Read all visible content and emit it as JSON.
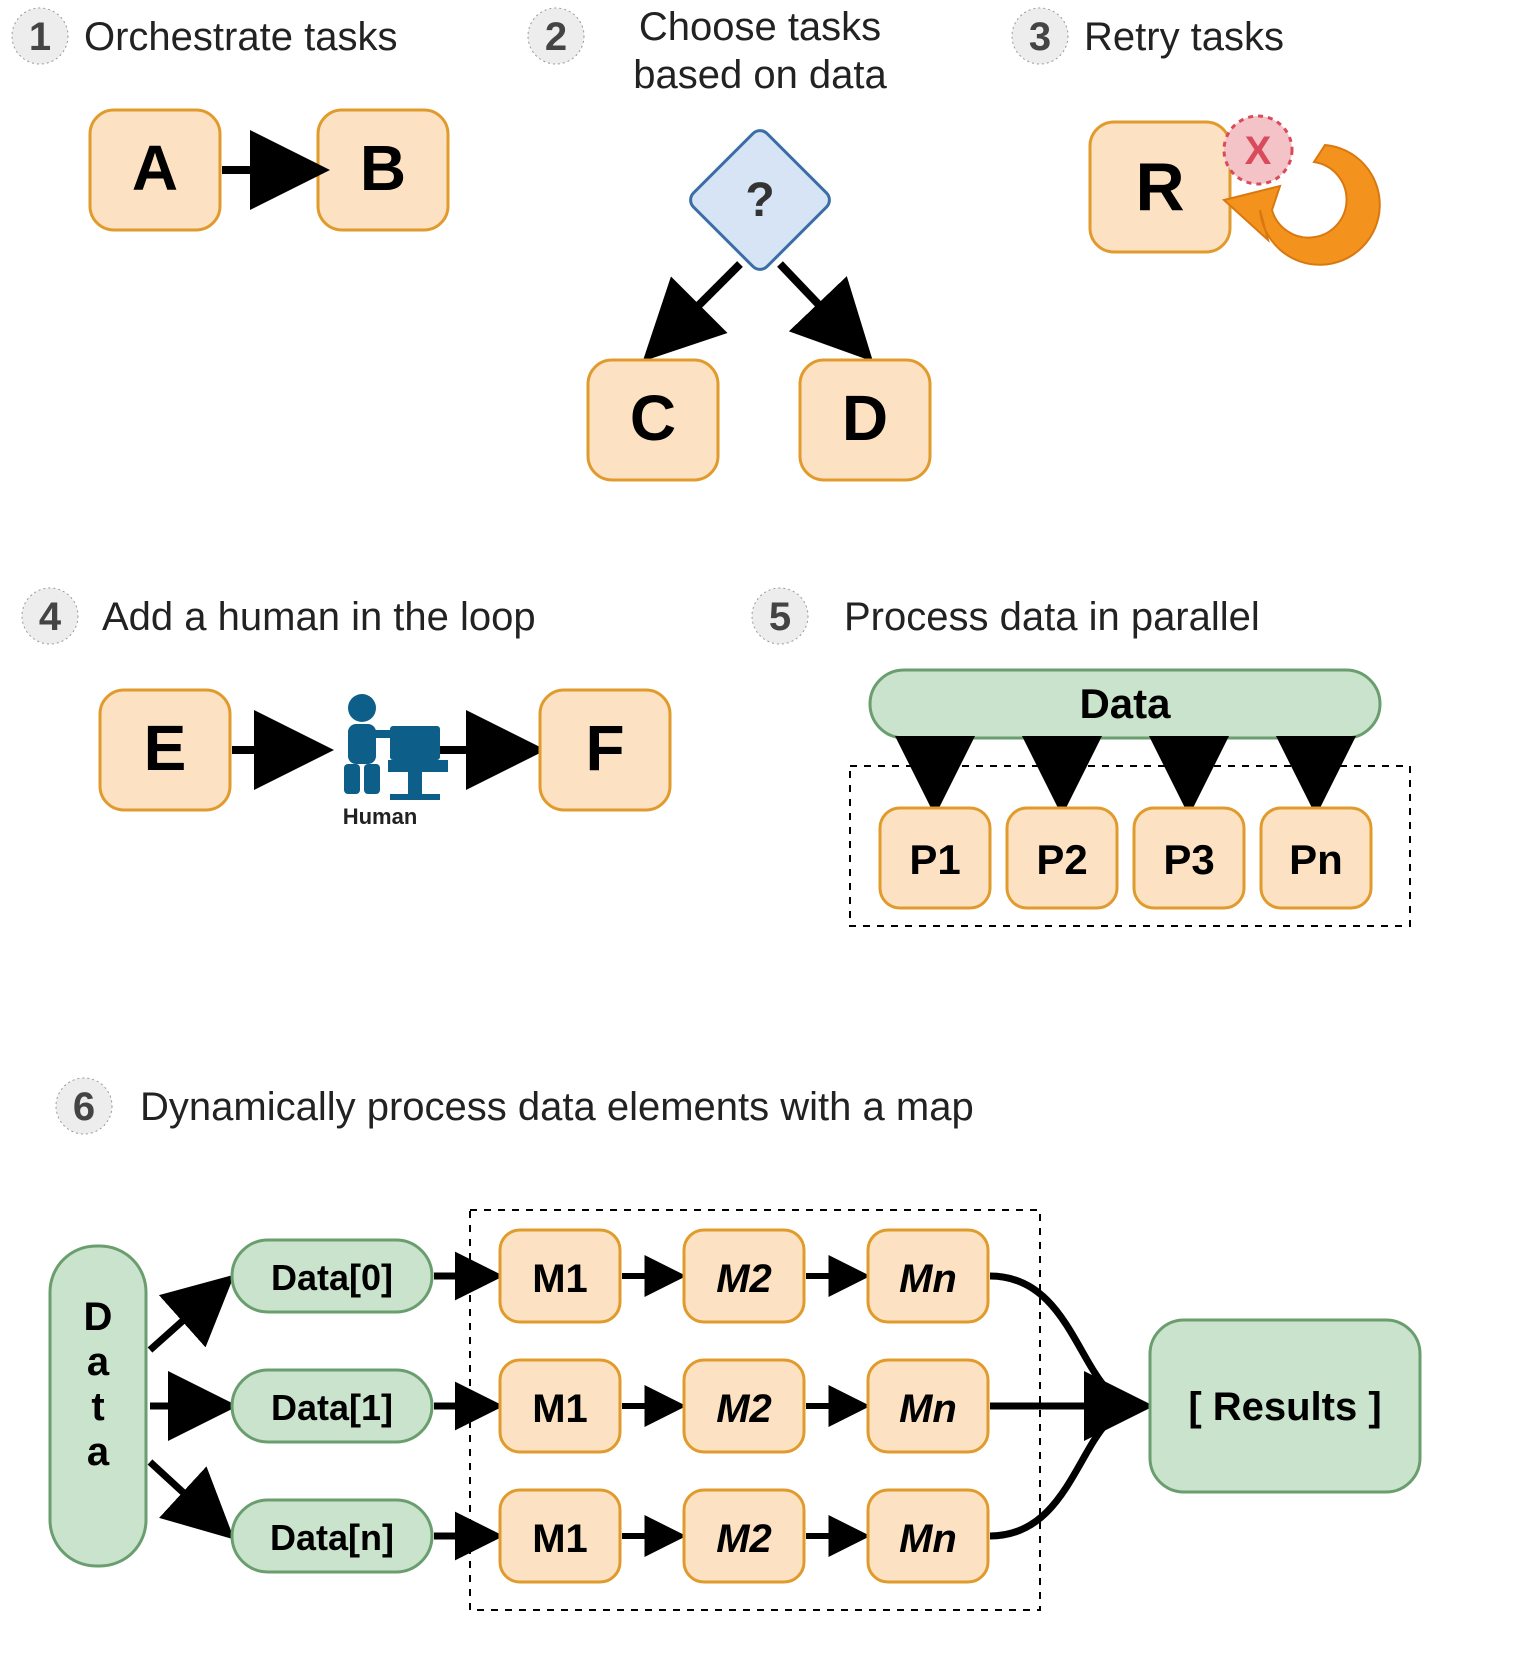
{
  "panels": {
    "1": {
      "num": "1",
      "title": "Orchestrate tasks",
      "boxes": {
        "A": "A",
        "B": "B"
      }
    },
    "2": {
      "num": "2",
      "title": "Choose tasks based on data",
      "decision": "?",
      "boxes": {
        "C": "C",
        "D": "D"
      }
    },
    "3": {
      "num": "3",
      "title": "Retry tasks",
      "box": "R",
      "error": "X"
    },
    "4": {
      "num": "4",
      "title": "Add a human in the loop",
      "boxes": {
        "E": "E",
        "F": "F"
      },
      "human_label": "Human"
    },
    "5": {
      "num": "5",
      "title": "Process data in parallel",
      "data_label": "Data",
      "boxes": [
        "P1",
        "P2",
        "P3",
        "Pn"
      ]
    },
    "6": {
      "num": "6",
      "title": "Dynamically process data elements with a map",
      "data_label": "Data",
      "rows": [
        "Data[0]",
        "Data[1]",
        "Data[n]"
      ],
      "steps": [
        "M1",
        "M2",
        "Mn"
      ],
      "results": "[ Results ]"
    }
  },
  "colors": {
    "task_fill": "#FCE2C2",
    "task_stroke": "#E19B2D",
    "decision_fill": "#D6E4F6",
    "decision_stroke": "#3A6EA5",
    "data_fill": "#CAE3CC",
    "data_stroke": "#6A9E6E",
    "badge_fill": "#EDEDED",
    "error_fill": "#F4C3C7",
    "error_stroke": "#D94A5B",
    "retry": "#F3931E",
    "human": "#0D5F8A"
  }
}
